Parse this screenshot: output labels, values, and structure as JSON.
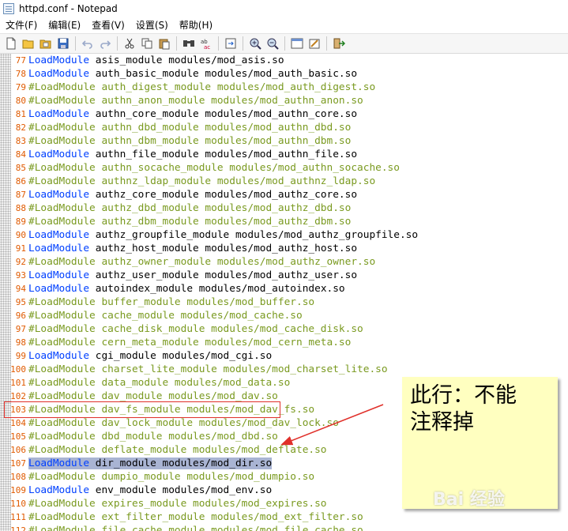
{
  "window": {
    "title": "httpd.conf - Notepad"
  },
  "menu": [
    "文件(F)",
    "编辑(E)",
    "查看(V)",
    "设置(S)",
    "帮助(H)"
  ],
  "toolbar": [
    "new-file-icon",
    "open-file-icon",
    "open-folder-icon",
    "save-icon",
    "sep",
    "undo-icon",
    "redo-icon",
    "sep",
    "cut-icon",
    "copy-icon",
    "paste-icon",
    "sep",
    "find-icon",
    "replace-icon",
    "sep",
    "goto-icon",
    "sep",
    "zoom-in-icon",
    "zoom-out-icon",
    "sep",
    "view-icon",
    "settings-icon",
    "sep",
    "exit-icon"
  ],
  "lines": [
    {
      "n": "77",
      "t": "LoadModule asis_module modules/mod_asis.so",
      "c": false
    },
    {
      "n": "78",
      "t": "LoadModule auth_basic_module modules/mod_auth_basic.so",
      "c": false
    },
    {
      "n": "79",
      "t": "#LoadModule auth_digest_module modules/mod_auth_digest.so",
      "c": true
    },
    {
      "n": "80",
      "t": "#LoadModule authn_anon_module modules/mod_authn_anon.so",
      "c": true
    },
    {
      "n": "81",
      "t": "LoadModule authn_core_module modules/mod_authn_core.so",
      "c": false
    },
    {
      "n": "82",
      "t": "#LoadModule authn_dbd_module modules/mod_authn_dbd.so",
      "c": true
    },
    {
      "n": "83",
      "t": "#LoadModule authn_dbm_module modules/mod_authn_dbm.so",
      "c": true
    },
    {
      "n": "84",
      "t": "LoadModule authn_file_module modules/mod_authn_file.so",
      "c": false
    },
    {
      "n": "85",
      "t": "#LoadModule authn_socache_module modules/mod_authn_socache.so",
      "c": true
    },
    {
      "n": "86",
      "t": "#LoadModule authnz_ldap_module modules/mod_authnz_ldap.so",
      "c": true
    },
    {
      "n": "87",
      "t": "LoadModule authz_core_module modules/mod_authz_core.so",
      "c": false
    },
    {
      "n": "88",
      "t": "#LoadModule authz_dbd_module modules/mod_authz_dbd.so",
      "c": true
    },
    {
      "n": "89",
      "t": "#LoadModule authz_dbm_module modules/mod_authz_dbm.so",
      "c": true
    },
    {
      "n": "90",
      "t": "LoadModule authz_groupfile_module modules/mod_authz_groupfile.so",
      "c": false
    },
    {
      "n": "91",
      "t": "LoadModule authz_host_module modules/mod_authz_host.so",
      "c": false
    },
    {
      "n": "92",
      "t": "#LoadModule authz_owner_module modules/mod_authz_owner.so",
      "c": true
    },
    {
      "n": "93",
      "t": "LoadModule authz_user_module modules/mod_authz_user.so",
      "c": false
    },
    {
      "n": "94",
      "t": "LoadModule autoindex_module modules/mod_autoindex.so",
      "c": false
    },
    {
      "n": "95",
      "t": "#LoadModule buffer_module modules/mod_buffer.so",
      "c": true
    },
    {
      "n": "96",
      "t": "#LoadModule cache_module modules/mod_cache.so",
      "c": true
    },
    {
      "n": "97",
      "t": "#LoadModule cache_disk_module modules/mod_cache_disk.so",
      "c": true
    },
    {
      "n": "98",
      "t": "#LoadModule cern_meta_module modules/mod_cern_meta.so",
      "c": true
    },
    {
      "n": "99",
      "t": "LoadModule cgi_module modules/mod_cgi.so",
      "c": false
    },
    {
      "n": "100",
      "t": "#LoadModule charset_lite_module modules/mod_charset_lite.so",
      "c": true
    },
    {
      "n": "101",
      "t": "#LoadModule data_module modules/mod_data.so",
      "c": true
    },
    {
      "n": "102",
      "t": "#LoadModule dav_module modules/mod_dav.so",
      "c": true
    },
    {
      "n": "103",
      "t": "#LoadModule dav_fs_module modules/mod_dav_fs.so",
      "c": true
    },
    {
      "n": "104",
      "t": "#LoadModule dav_lock_module modules/mod_dav_lock.so",
      "c": true
    },
    {
      "n": "105",
      "t": "#LoadModule dbd_module modules/mod_dbd.so",
      "c": true
    },
    {
      "n": "106",
      "t": "#LoadModule deflate_module modules/mod_deflate.so",
      "c": true
    },
    {
      "n": "107",
      "t": "LoadModule dir_module modules/mod_dir.so",
      "c": false,
      "selected": true
    },
    {
      "n": "108",
      "t": "#LoadModule dumpio_module modules/mod_dumpio.so",
      "c": true
    },
    {
      "n": "109",
      "t": "LoadModule env_module modules/mod_env.so",
      "c": false
    },
    {
      "n": "110",
      "t": "#LoadModule expires_module modules/mod_expires.so",
      "c": true
    },
    {
      "n": "111",
      "t": "#LoadModule ext_filter_module modules/mod_ext_filter.so",
      "c": true
    },
    {
      "n": "112",
      "t": "#LoadModule file_cache_module modules/mod_file_cache.so",
      "c": true
    }
  ],
  "annotation": {
    "line1": "此行：不能",
    "line2": "注释掉"
  },
  "watermark": "Bai 经验",
  "colors": {
    "keyword": "#0040ff",
    "comment": "#7a9a20",
    "line_number": "#e05a00",
    "note_bg": "#ffffc0",
    "highlight": "#e0302a"
  }
}
